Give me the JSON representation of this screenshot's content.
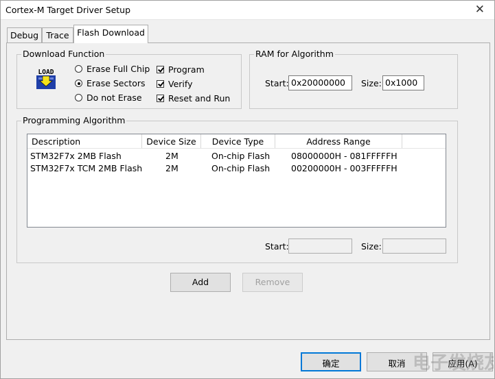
{
  "window": {
    "title": "Cortex-M Target Driver Setup",
    "close_glyph": "✕"
  },
  "tabs": [
    {
      "label": "Debug"
    },
    {
      "label": "Trace"
    },
    {
      "label": "Flash Download"
    }
  ],
  "download_function": {
    "legend": "Download Function",
    "icon_text": "LOAD",
    "radios": [
      {
        "label": "Erase Full Chip",
        "selected": false
      },
      {
        "label": "Erase Sectors",
        "selected": true
      },
      {
        "label": "Do not Erase",
        "selected": false
      }
    ],
    "checks": [
      {
        "label": "Program",
        "checked": true
      },
      {
        "label": "Verify",
        "checked": true
      },
      {
        "label": "Reset and Run",
        "checked": true
      }
    ]
  },
  "ram": {
    "legend": "RAM for Algorithm",
    "start_label": "Start:",
    "start_value": "0x20000000",
    "size_label": "Size:",
    "size_value": "0x1000"
  },
  "programming_algorithm": {
    "legend": "Programming Algorithm",
    "columns": [
      "Description",
      "Device Size",
      "Device Type",
      "Address Range"
    ],
    "rows": [
      [
        "STM32F7x 2MB Flash",
        "2M",
        "On-chip Flash",
        "08000000H - 081FFFFFH"
      ],
      [
        "STM32F7x TCM 2MB Flash",
        "2M",
        "On-chip Flash",
        "00200000H - 003FFFFFH"
      ]
    ],
    "start_label": "Start:",
    "start_value": "",
    "size_label": "Size:",
    "size_value": ""
  },
  "buttons": {
    "add": "Add",
    "remove": "Remove",
    "ok": "确定",
    "cancel": "取消",
    "apply": "应用(A)"
  },
  "watermark": "电子发烧友网"
}
